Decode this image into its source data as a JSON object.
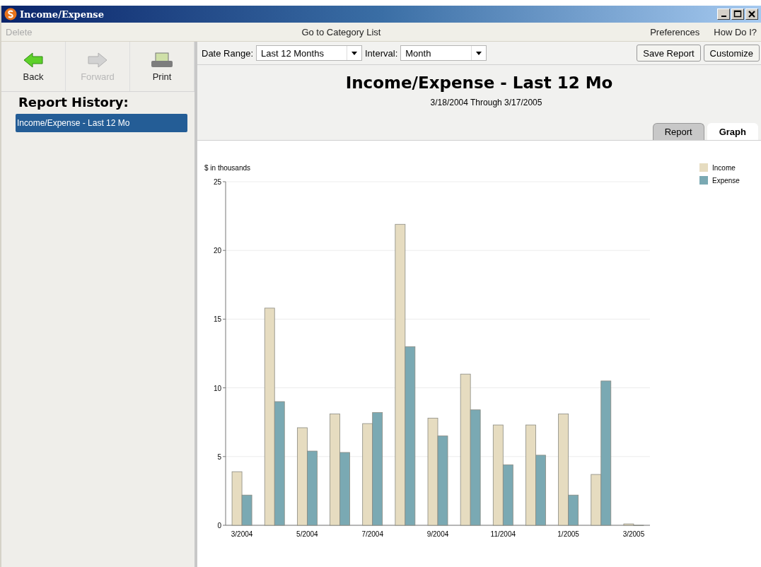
{
  "window": {
    "title": "Income/Expense"
  },
  "menu": {
    "left": [
      {
        "label": "Delete",
        "disabled": true
      }
    ],
    "center": [
      {
        "label": "Go to Category List",
        "disabled": false
      }
    ],
    "right": [
      {
        "label": "Preferences",
        "disabled": false
      },
      {
        "label": "How Do I?",
        "disabled": false
      }
    ]
  },
  "nav_buttons": [
    {
      "label": "Back",
      "kind": "back",
      "disabled": false
    },
    {
      "label": "Forward",
      "kind": "forward",
      "disabled": true
    },
    {
      "label": "Print",
      "kind": "print",
      "disabled": false
    }
  ],
  "history": {
    "title": "Report History:",
    "items": [
      {
        "label": "Income/Expense - Last 12 Mo",
        "selected": true
      }
    ]
  },
  "filters": [
    {
      "label": "Date Range:",
      "value": "Last 12 Months"
    },
    {
      "label": "Interval:",
      "value": "Month"
    }
  ],
  "actions": [
    "Save Report",
    "Customize"
  ],
  "report": {
    "title": "Income/Expense - Last 12 Mo",
    "subtitle": "3/18/2004 Through 3/17/2005"
  },
  "tabs": [
    {
      "label": "Report",
      "selected": false
    },
    {
      "label": "Graph",
      "selected": true
    }
  ],
  "chart": {
    "chart_data": {
      "type": "bar",
      "ylabel": "$ in thousands",
      "categories": [
        "3/2004",
        null,
        "5/2004",
        null,
        "7/2004",
        null,
        "9/2004",
        null,
        "11/2004",
        null,
        "1/2005",
        null,
        "3/2005"
      ],
      "grid": true,
      "legend": true,
      "ylim": [
        0,
        25
      ],
      "yticks": [
        0,
        5,
        10,
        15,
        20,
        25
      ],
      "series": [
        {
          "name": "Income",
          "color": "#e6dcc0",
          "values": [
            3.9,
            15.8,
            7.1,
            8.1,
            7.4,
            21.9,
            7.8,
            11.0,
            7.3,
            7.3,
            8.1,
            3.7,
            0.1
          ]
        },
        {
          "name": "Expense",
          "color": "#7aa9b3",
          "values": [
            2.2,
            9.0,
            5.4,
            5.3,
            8.2,
            13.0,
            6.5,
            8.4,
            4.4,
            5.1,
            2.2,
            10.5,
            0
          ]
        }
      ]
    }
  }
}
